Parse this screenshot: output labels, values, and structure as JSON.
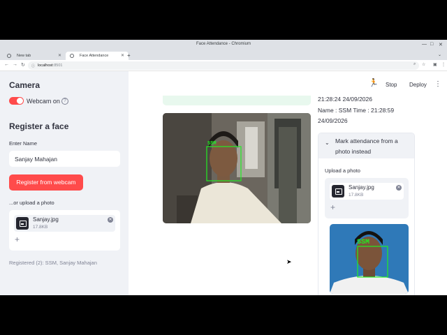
{
  "browser": {
    "window_title": "Face Attendance - Chromium",
    "tabs": [
      {
        "label": "New tab",
        "active": false
      },
      {
        "label": "Face Attendance",
        "active": true
      }
    ],
    "url_host": "localhost",
    "url_port": ":8501"
  },
  "header": {
    "stop_label": "Stop",
    "deploy_label": "Deploy"
  },
  "sidebar": {
    "camera_title": "Camera",
    "webcam_toggle_label": "Webcam on",
    "webcam_on": true,
    "register_title": "Register a face",
    "name_label": "Enter Name",
    "name_value": "Sanjay Mahajan",
    "register_button": "Register from webcam",
    "upload_label": "...or upload a photo",
    "file": {
      "name": "Sanjay.jpg",
      "size": "17.8KB"
    },
    "registered_text": "Registered (2): SSM, Sanjay Mahajan"
  },
  "main": {
    "webcam_face_label": "SSM",
    "attendance_log": [
      "21:28:24 24/09/2026",
      "Name : SSM Time : 21:28:59",
      "24/09/2026"
    ],
    "expander_title": "Mark attendance from a photo instead",
    "upload_label": "Upload a photo",
    "file": {
      "name": "Sanjay.jpg",
      "size": "17.8KB"
    },
    "photo_face_label": "SSM"
  },
  "colors": {
    "primary": "#ff4b4b",
    "sidebar_bg": "#f0f2f6",
    "face_box": "#22ee22"
  },
  "icons": [
    "running-man-icon",
    "kebab-menu-icon",
    "image-file-icon",
    "close-icon",
    "plus-icon",
    "chevron-down-icon",
    "help-icon"
  ]
}
